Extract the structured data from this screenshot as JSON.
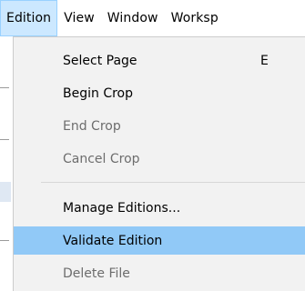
{
  "menubar": {
    "items": [
      {
        "label": "Edition",
        "active": true
      },
      {
        "label": "View",
        "active": false
      },
      {
        "label": "Window",
        "active": false
      },
      {
        "label": "Worksp",
        "active": false
      }
    ]
  },
  "edition_menu": {
    "items": [
      {
        "label": "Select Page",
        "shortcut": "E",
        "enabled": true,
        "highlighted": false
      },
      {
        "label": "Begin Crop",
        "enabled": true,
        "highlighted": false
      },
      {
        "label": "End Crop",
        "enabled": false,
        "highlighted": false
      },
      {
        "label": "Cancel Crop",
        "enabled": false,
        "highlighted": false
      },
      {
        "label": "Manage Editions...",
        "enabled": true,
        "highlighted": false
      },
      {
        "label": "Validate Edition",
        "enabled": true,
        "highlighted": true
      },
      {
        "label": "Delete File",
        "enabled": false,
        "highlighted": false
      }
    ]
  },
  "colors": {
    "active_menubar_bg": "#cce8ff",
    "menu_bg": "#f2f2f2",
    "highlight_bg": "#91c9f7",
    "disabled_text": "#6d6d6d"
  }
}
